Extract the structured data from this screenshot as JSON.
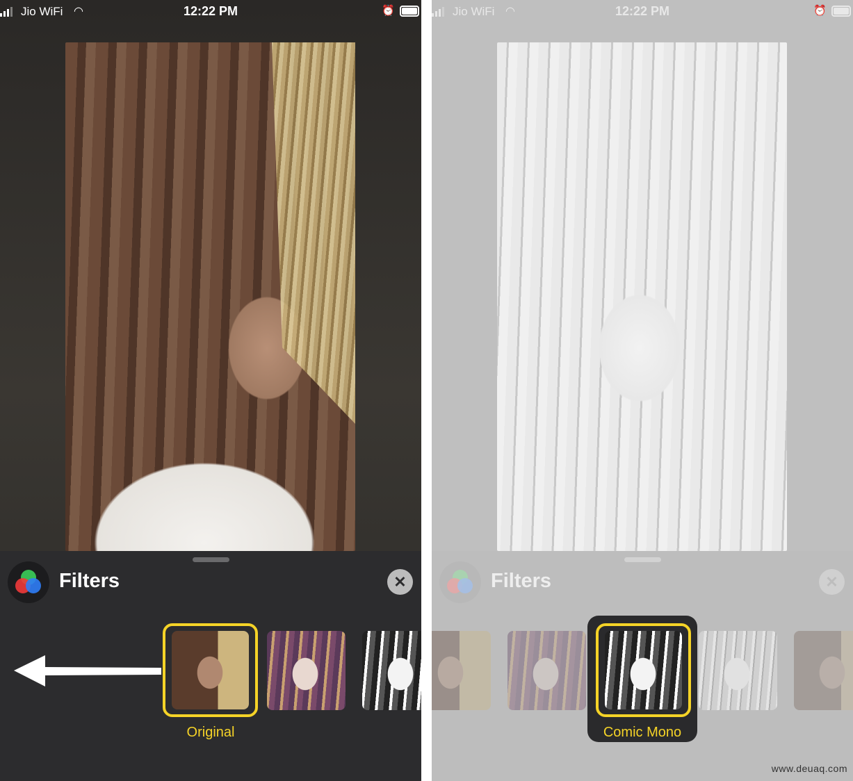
{
  "screens": [
    {
      "status": {
        "carrier": "Jio WiFi",
        "time": "12:22 PM"
      },
      "sheet": {
        "title": "Filters",
        "close_icon": "close-icon"
      },
      "selected_filter": "Original"
    },
    {
      "status": {
        "carrier": "Jio WiFi",
        "time": "12:22 PM"
      },
      "sheet": {
        "title": "Filters",
        "close_icon": "close-icon"
      },
      "selected_filter": "Comic Mono"
    }
  ],
  "colors": {
    "accent": "#f5d327",
    "sheet_dark": "#2c2c2e",
    "sheet_dimmed": "#bdbdbd"
  },
  "watermark": "www.deuaq.com"
}
